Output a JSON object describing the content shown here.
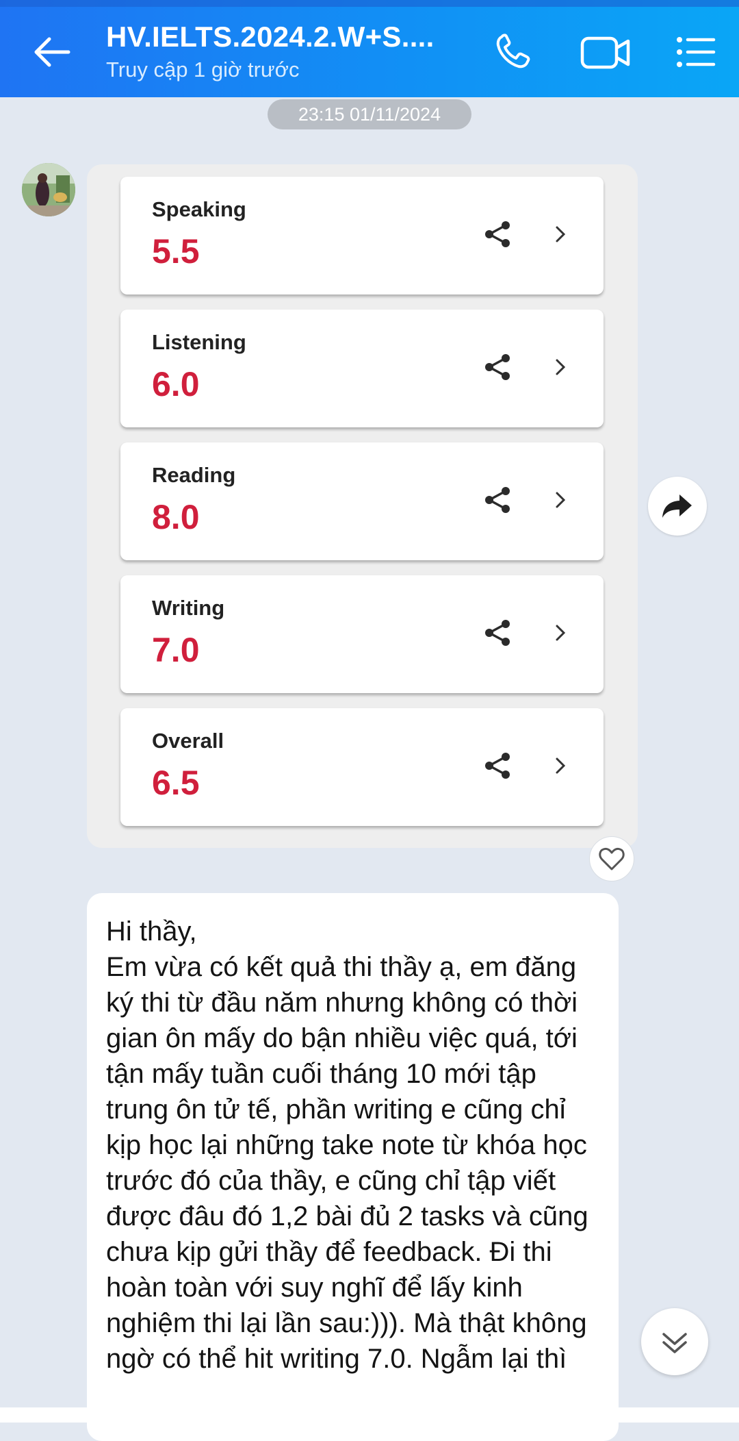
{
  "header": {
    "title": "HV.IELTS.2024.2.W+S....",
    "status": "Truy cập 1 giờ trước"
  },
  "icons": {
    "back": "arrow-left-icon",
    "call": "phone-icon",
    "video": "video-camera-icon",
    "menu": "list-menu-icon",
    "share": "share-icon",
    "forward": "forward-arrow-icon",
    "react": "heart-icon",
    "scroll": "double-chevron-down-icon"
  },
  "conversation": {
    "timestamp": "23:15 01/11/2024",
    "scores": [
      {
        "label": "Speaking",
        "value": "5.5"
      },
      {
        "label": "Listening",
        "value": "6.0"
      },
      {
        "label": "Reading",
        "value": "8.0"
      },
      {
        "label": "Writing",
        "value": "7.0"
      },
      {
        "label": "Overall",
        "value": "6.5"
      }
    ],
    "message": "Hi thầy,\nEm vừa có kết quả thi thầy ạ, em đăng ký thi từ đầu năm nhưng không có thời gian ôn mấy do bận nhiều việc quá, tới tận mấy tuần cuối tháng 10 mới tập trung ôn tử tế, phần writing e cũng chỉ kịp học lại những take note từ khóa học trước đó của thầy, e cũng chỉ tập viết được đâu đó 1,2 bài đủ 2 tasks và cũng chưa kịp gửi thầy để feedback. Đi thi hoàn toàn với suy nghĩ để lấy kinh nghiệm thi lại lần sau:))). Mà thật không ngờ có thể hit writing 7.0. Ngẫm lại thì"
  },
  "colors": {
    "header_start": "#1f74f3",
    "header_end": "#0aa6f6",
    "score_red": "#d01f3c",
    "chat_bg": "#e2e8f1"
  }
}
